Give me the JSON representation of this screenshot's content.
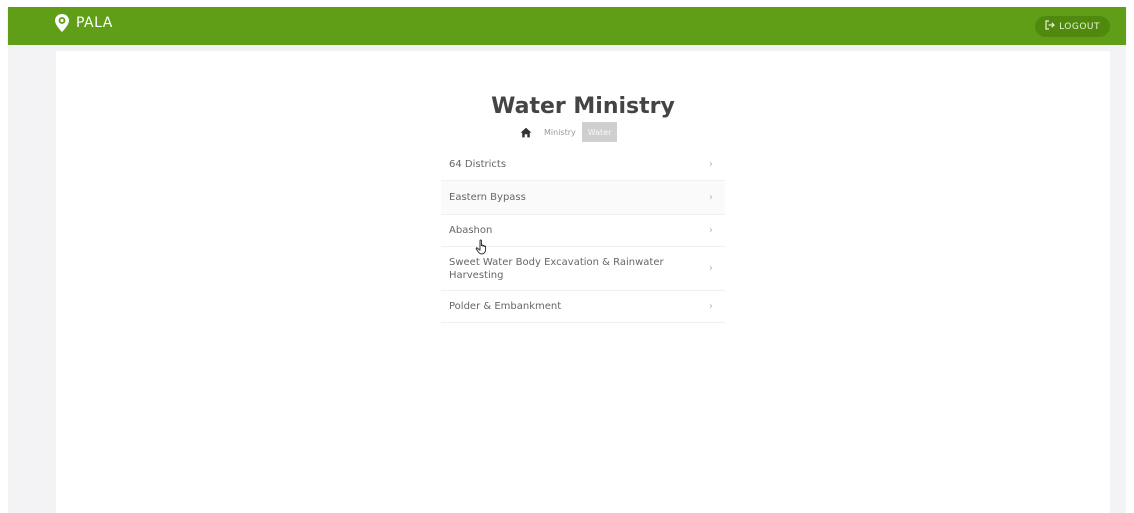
{
  "header": {
    "brand_name": "PALA",
    "brand_icon": "map-pin-icon",
    "logout_label": "LOGOUT",
    "logout_icon": "logout-icon",
    "bar_color": "#5f9e16"
  },
  "main": {
    "title": "Water Ministry",
    "breadcrumb": {
      "home_icon": "home-icon",
      "items": [
        "Ministry",
        "Water"
      ]
    },
    "menu_items": [
      {
        "label": "64 Districts"
      },
      {
        "label": "Eastern Bypass"
      },
      {
        "label": "Abashon"
      },
      {
        "label": "Sweet Water Body Excavation & Rainwater Harvesting"
      },
      {
        "label": "Polder & Embankment"
      }
    ],
    "chevron": "›"
  }
}
